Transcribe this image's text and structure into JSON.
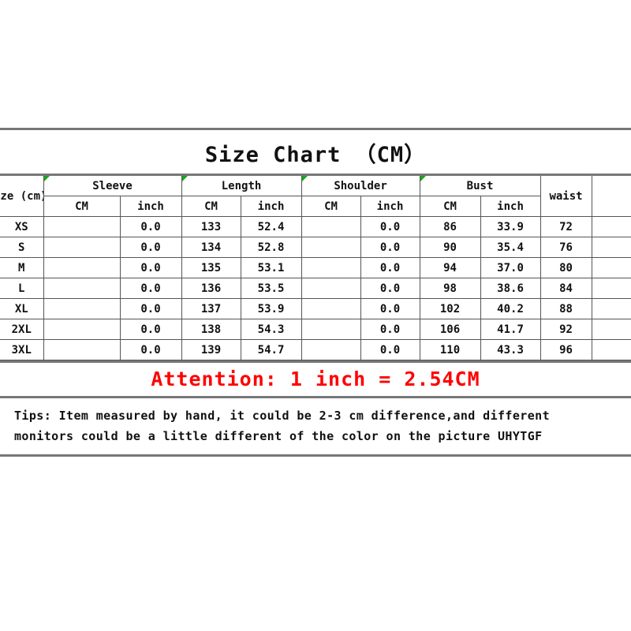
{
  "title": "Size Chart （CM）",
  "colors": {
    "accent_red": "#ff0000",
    "text": "#111111",
    "grid": "#555555",
    "outer_rule": "#777777",
    "comment_marker_green": "#17a81a"
  },
  "table": {
    "size_header": "ize (cm)",
    "groups": [
      {
        "label": "Sleeve",
        "has_comment_marker": true,
        "units": [
          "CM",
          "inch"
        ]
      },
      {
        "label": "Length",
        "has_comment_marker": true,
        "units": [
          "CM",
          "inch"
        ]
      },
      {
        "label": "Shoulder",
        "has_comment_marker": true,
        "units": [
          "CM",
          "inch"
        ]
      },
      {
        "label": "Bust",
        "has_comment_marker": true,
        "units": [
          "CM",
          "inch"
        ]
      },
      {
        "label": "waist",
        "has_comment_marker": false,
        "units": [
          ""
        ]
      },
      {
        "label": "",
        "has_comment_marker": false,
        "units": [
          ""
        ]
      }
    ],
    "unit_cm": "CM",
    "unit_inch": "inch",
    "rows": [
      {
        "size": "XS",
        "sleeve_cm": "",
        "sleeve_inch": "0.0",
        "length_cm": "133",
        "length_inch": "52.4",
        "shoulder_cm": "",
        "shoulder_inch": "0.0",
        "bust_cm": "86",
        "bust_inch": "33.9",
        "waist_cm": "72",
        "extra": ""
      },
      {
        "size": "S",
        "sleeve_cm": "",
        "sleeve_inch": "0.0",
        "length_cm": "134",
        "length_inch": "52.8",
        "shoulder_cm": "",
        "shoulder_inch": "0.0",
        "bust_cm": "90",
        "bust_inch": "35.4",
        "waist_cm": "76",
        "extra": ""
      },
      {
        "size": "M",
        "sleeve_cm": "",
        "sleeve_inch": "0.0",
        "length_cm": "135",
        "length_inch": "53.1",
        "shoulder_cm": "",
        "shoulder_inch": "0.0",
        "bust_cm": "94",
        "bust_inch": "37.0",
        "waist_cm": "80",
        "extra": ""
      },
      {
        "size": "L",
        "sleeve_cm": "",
        "sleeve_inch": "0.0",
        "length_cm": "136",
        "length_inch": "53.5",
        "shoulder_cm": "",
        "shoulder_inch": "0.0",
        "bust_cm": "98",
        "bust_inch": "38.6",
        "waist_cm": "84",
        "extra": ""
      },
      {
        "size": "XL",
        "sleeve_cm": "",
        "sleeve_inch": "0.0",
        "length_cm": "137",
        "length_inch": "53.9",
        "shoulder_cm": "",
        "shoulder_inch": "0.0",
        "bust_cm": "102",
        "bust_inch": "40.2",
        "waist_cm": "88",
        "extra": ""
      },
      {
        "size": "2XL",
        "sleeve_cm": "",
        "sleeve_inch": "0.0",
        "length_cm": "138",
        "length_inch": "54.3",
        "shoulder_cm": "",
        "shoulder_inch": "0.0",
        "bust_cm": "106",
        "bust_inch": "41.7",
        "waist_cm": "92",
        "extra": ""
      },
      {
        "size": "3XL",
        "sleeve_cm": "",
        "sleeve_inch": "0.0",
        "length_cm": "139",
        "length_inch": "54.7",
        "shoulder_cm": "",
        "shoulder_inch": "0.0",
        "bust_cm": "110",
        "bust_inch": "43.3",
        "waist_cm": "96",
        "extra": ""
      }
    ]
  },
  "attention": "Attention: 1 inch = 2.54CM",
  "tips": {
    "line1": "Tips: Item measured by hand, it could be 2-3 cm difference,and different",
    "line2": "monitors could be a little different of the color on the picture UHYTGF"
  }
}
